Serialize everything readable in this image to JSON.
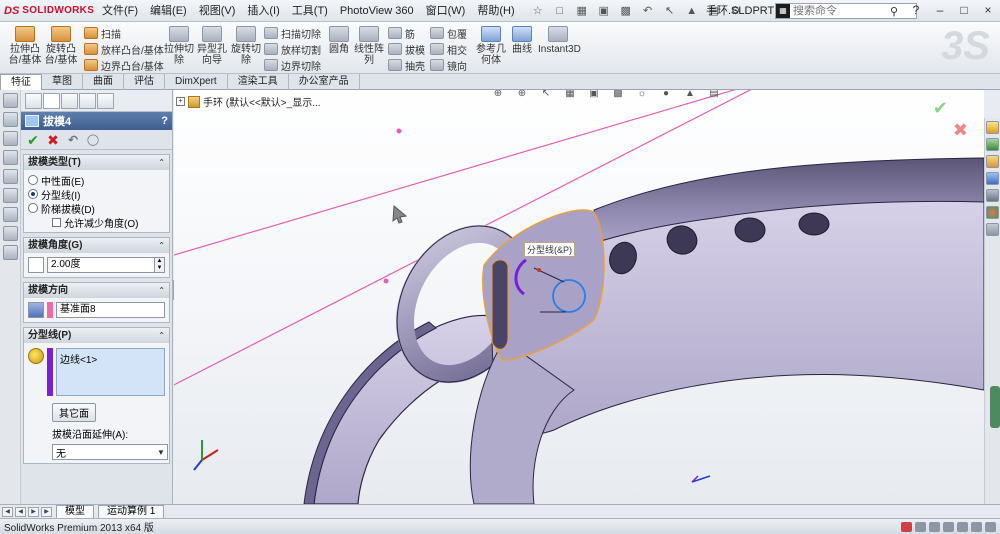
{
  "app": {
    "logo_ds": "DS",
    "logo_name": "SOLIDWORKS"
  },
  "menus": [
    "文件(F)",
    "编辑(E)",
    "视图(V)",
    "插入(I)",
    "工具(T)",
    "PhotoView 360",
    "窗口(W)",
    "帮助(H)"
  ],
  "document_title": "手环.SLDPRT *",
  "search": {
    "placeholder": "搜索命令"
  },
  "command_manager": {
    "extrude_boss": "拉伸凸\n台/基体",
    "revolve_boss": "旋转凸\n台/基体",
    "sweep": "扫描",
    "loft_boss": "放样凸台/基体",
    "boundary_boss": "边界凸台/基体",
    "extrude_cut": "拉伸切\n除",
    "hole_wizard": "异型孔\n向导",
    "revolve_cut": "旋转切\n除",
    "swept_cut": "扫描切除",
    "lofted_cut": "放样切割",
    "boundary_cut": "边界切除",
    "fillet": "圆角",
    "linear_pattern": "线性阵\n列",
    "rib": "筋",
    "draft": "拔模",
    "shell": "抽壳",
    "wrap": "包覆",
    "intersect": "相交",
    "mirror": "镜向",
    "reference_geometry": "参考几\n何体",
    "curves": "曲线",
    "instant3d": "Instant3D"
  },
  "tabs": [
    "特征",
    "草图",
    "曲面",
    "评估",
    "DimXpert",
    "渲染工具",
    "办公室产品"
  ],
  "active_tab": "特征",
  "property_manager": {
    "title": "拔模4",
    "help": "?",
    "draft_type": {
      "header": "拔模类型(T)",
      "options": [
        "中性面(E)",
        "分型线(I)",
        "阶梯拔模(D)"
      ],
      "selected": 1,
      "checkbox_label": "允许减少角度(O)"
    },
    "draft_angle": {
      "header": "拔模角度(G)",
      "value": "2.00度"
    },
    "draft_direction": {
      "header": "拔模方向",
      "value": "基准面8"
    },
    "parting_lines": {
      "header": "分型线(P)",
      "items": [
        "边线<1>"
      ],
      "other_face_button": "其它面",
      "extend_label": "拔模沿面延伸(A):",
      "extend_value": "无"
    }
  },
  "feature_tree": {
    "root_label": "手环  (默认<<默认>_显示..."
  },
  "viewport": {
    "callout_label": "分型线(&P)"
  },
  "bottom_tabs": [
    "模型",
    "运动算例 1"
  ],
  "active_bottom_tab": "模型",
  "status": {
    "text": "SolidWorks Premium 2013 x64 版"
  },
  "colors": {
    "accent_blue": "#3f5e8e",
    "ok_green": "#1f9b27",
    "cancel_red": "#cc1f1f",
    "parting_purple": "#7a1fd1",
    "direction_pink": "#ee6aa8",
    "model_surface": "#c9c3df",
    "sketch_line": "#e060b8",
    "edge_orange": "#f0a030"
  }
}
